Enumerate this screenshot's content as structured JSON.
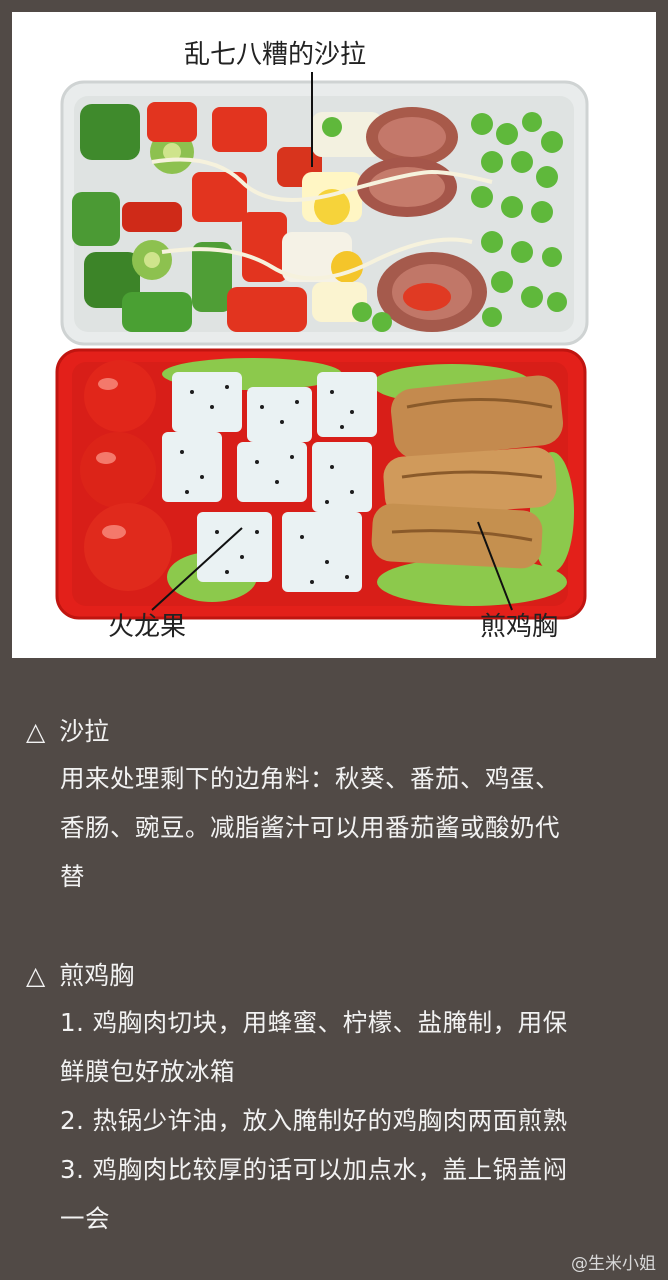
{
  "photo": {
    "labels": {
      "salad": "乱七八糟的沙拉",
      "dragonfruit": "火龙果",
      "chicken": "煎鸡胸"
    }
  },
  "sections": [
    {
      "marker": "△",
      "title": "沙拉",
      "lines": [
        "用来处理剩下的边角料：秋葵、番茄、鸡蛋、",
        "香肠、豌豆。减脂酱汁可以用番茄酱或酸奶代",
        "替"
      ]
    },
    {
      "marker": "△",
      "title": "煎鸡胸",
      "lines": [
        "1. 鸡胸肉切块，用蜂蜜、柠檬、盐腌制，用保",
        "鲜膜包好放冰箱",
        "2. 热锅少许油，放入腌制好的鸡胸肉两面煎熟",
        "3. 鸡胸肉比较厚的话可以加点水，盖上锅盖闷",
        "一会"
      ]
    }
  ],
  "watermark": "@生米小姐"
}
